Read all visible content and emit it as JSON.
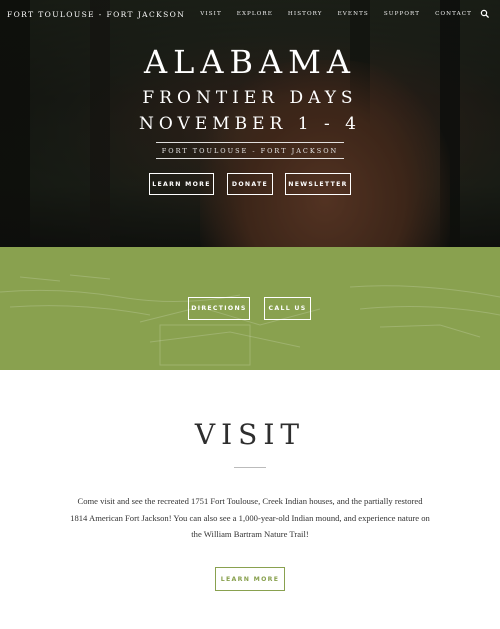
{
  "header": {
    "brand": "FORT TOULOUSE - FORT JACKSON",
    "nav": [
      "VISIT",
      "EXPLORE",
      "HISTORY",
      "EVENTS",
      "SUPPORT",
      "CONTACT"
    ],
    "search_icon": "search-icon"
  },
  "hero": {
    "title": "ALABAMA",
    "subtitle": "FRONTIER DAYS",
    "date": "NOVEMBER 1 - 4",
    "location": "FORT TOULOUSE - FORT JACKSON",
    "buttons": [
      "LEARN MORE",
      "DONATE",
      "NEWSLETTER"
    ]
  },
  "band": {
    "color": "#89a14f",
    "buttons": [
      "DIRECTIONS",
      "CALL US"
    ]
  },
  "visit": {
    "title": "VISIT",
    "body": "Come visit and see the recreated 1751 Fort Toulouse, Creek Indian houses, and the partially restored 1814 American Fort Jackson! You can also see a 1,000-year-old Indian mound, and experience nature on the William Bartram Nature Trail!",
    "button": "LEARN MORE"
  }
}
